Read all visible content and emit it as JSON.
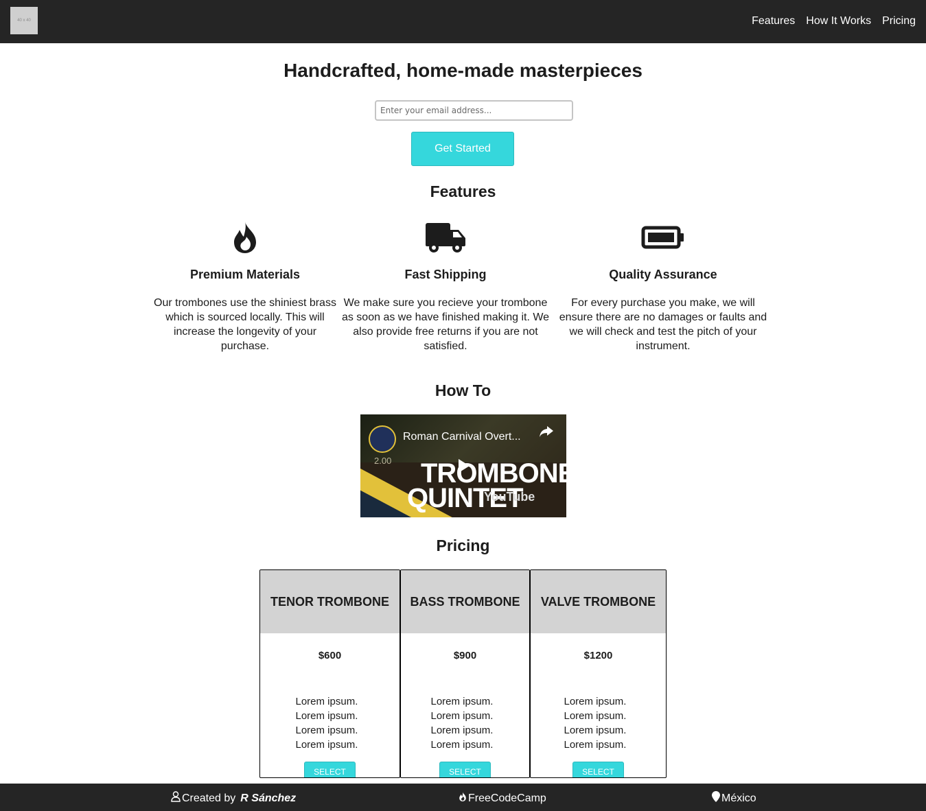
{
  "header": {
    "logo_text": "40 x 40",
    "nav": [
      "Features",
      "How It Works",
      "Pricing"
    ]
  },
  "hero": {
    "title": "Handcrafted, home-made masterpieces",
    "email_placeholder": "Enter your email address...",
    "cta_label": "Get Started"
  },
  "features": {
    "title": "Features",
    "items": [
      {
        "icon": "fire-icon",
        "title": "Premium Materials",
        "text": "Our trombones use the shiniest brass which is sourced locally. This will increase the longevity of your purchase."
      },
      {
        "icon": "truck-icon",
        "title": "Fast Shipping",
        "text": "We make sure you recieve your trombone as soon as we have finished making it. We also provide free returns if you are not satisfied."
      },
      {
        "icon": "battery-icon",
        "title": "Quality Assurance",
        "text": "For every purchase you make, we will ensure there are no damages or faults and we will check and test the pitch of your instrument."
      }
    ]
  },
  "howto": {
    "title": "How To",
    "video_title": "Roman Carnival Overt...",
    "video_overlay_line1": "TROMBONE",
    "video_overlay_line2": "QUINTET",
    "video_number": "2.00",
    "video_brand": "YouTube"
  },
  "pricing": {
    "title": "Pricing",
    "plans": [
      {
        "name": "Tenor Trombone",
        "price": "$600",
        "features": [
          "Lorem ipsum.",
          "Lorem ipsum.",
          "Lorem ipsum.",
          "Lorem ipsum."
        ],
        "button": "SELECT"
      },
      {
        "name": "Bass Trombone",
        "price": "$900",
        "features": [
          "Lorem ipsum.",
          "Lorem ipsum.",
          "Lorem ipsum.",
          "Lorem ipsum."
        ],
        "button": "SELECT"
      },
      {
        "name": "Valve Trombone",
        "price": "$1200",
        "features": [
          "Lorem ipsum.",
          "Lorem ipsum.",
          "Lorem ipsum.",
          "Lorem ipsum."
        ],
        "button": "SELECT"
      }
    ]
  },
  "footer": {
    "created_by": "Created by",
    "author": "R Sánchez",
    "fcc": "FreeCodeCamp",
    "location": "México"
  },
  "colors": {
    "accent": "#35d7dc",
    "header_bg": "#252525",
    "card_head_bg": "#d3d3d3"
  }
}
